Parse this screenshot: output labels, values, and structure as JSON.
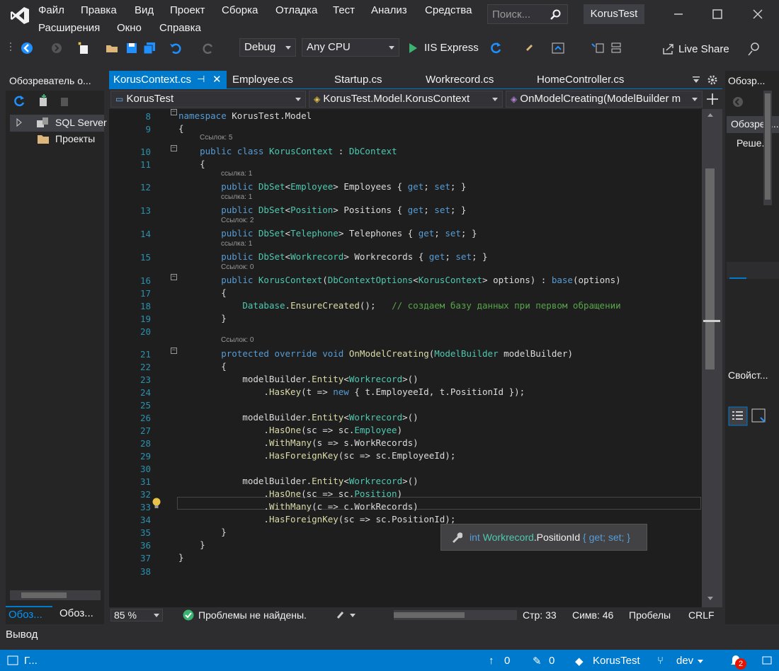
{
  "menu": [
    "Файл",
    "Правка",
    "Вид",
    "Проект",
    "Сборка",
    "Отладка",
    "Тест",
    "Анализ",
    "Средства",
    "Расширения",
    "Окно",
    "Справка"
  ],
  "search": {
    "placeholder": "Поиск..."
  },
  "project_name": "KorusTest",
  "toolbar": {
    "config": "Debug",
    "platform": "Any CPU",
    "run": "IIS Express",
    "live_share": "Live Share"
  },
  "left_panel": {
    "title": "Обозреватель о...",
    "items": [
      "SQL Server",
      "Проекты"
    ],
    "tabs": [
      "Обоз...",
      "Обоз..."
    ]
  },
  "editor_tabs": [
    "KorusContext.cs",
    "Employee.cs",
    "Startup.cs",
    "Workrecord.cs",
    "HomeController.cs"
  ],
  "nav": {
    "project": "KorusTest",
    "class": "KorusTest.Model.KorusContext",
    "member": "OnModelCreating(ModelBuilder m"
  },
  "code_lines": [
    {
      "n": "8",
      "t": "namespace KorusTest.Model"
    },
    {
      "n": "9",
      "t": "{"
    },
    {
      "n": "10",
      "t": "    public class KorusContext : DbContext",
      "lens": "Ссылок: 5"
    },
    {
      "n": "11",
      "t": "    {"
    },
    {
      "n": "12",
      "t": "        public DbSet<Employee> Employees { get; set; }",
      "lens": "ссылка: 1"
    },
    {
      "n": "13",
      "t": "        public DbSet<Position> Positions { get; set; }",
      "lens": "ссылка: 1"
    },
    {
      "n": "14",
      "t": "        public DbSet<Telephone> Telephones { get; set; }",
      "lens": "Ссылок: 2"
    },
    {
      "n": "15",
      "t": "        public DbSet<Workrecord> Workrecords { get; set; }",
      "lens": "ссылка: 1"
    },
    {
      "n": "16",
      "t": "        public KorusContext(DbContextOptions<KorusContext> options) : base(options)",
      "lens": "Ссылок: 0"
    },
    {
      "n": "17",
      "t": "        {"
    },
    {
      "n": "18",
      "t": "            Database.EnsureCreated();   // создаем базу данных при первом обращении"
    },
    {
      "n": "19",
      "t": "        }"
    },
    {
      "n": "20",
      "t": ""
    },
    {
      "n": "21",
      "t": "        protected override void OnModelCreating(ModelBuilder modelBuilder)",
      "lens": "Ссылок: 0"
    },
    {
      "n": "22",
      "t": "        {"
    },
    {
      "n": "23",
      "t": "            modelBuilder.Entity<Workrecord>()"
    },
    {
      "n": "24",
      "t": "                .HasKey(t => new { t.EmployeeId, t.PositionId });"
    },
    {
      "n": "25",
      "t": ""
    },
    {
      "n": "26",
      "t": "            modelBuilder.Entity<Workrecord>()"
    },
    {
      "n": "27",
      "t": "                .HasOne(sc => sc.Employee)"
    },
    {
      "n": "28",
      "t": "                .WithMany(s => s.WorkRecords)"
    },
    {
      "n": "29",
      "t": "                .HasForeignKey(sc => sc.EmployeeId);"
    },
    {
      "n": "30",
      "t": ""
    },
    {
      "n": "31",
      "t": "            modelBuilder.Entity<Workrecord>()"
    },
    {
      "n": "32",
      "t": "                .HasOne(sc => sc.Position)"
    },
    {
      "n": "33",
      "t": "                .WithMany(c => c.WorkRecords)"
    },
    {
      "n": "34",
      "t": "                .HasForeignKey(sc => sc.PositionId);"
    },
    {
      "n": "35",
      "t": "        }"
    },
    {
      "n": "36",
      "t": "    }"
    },
    {
      "n": "37",
      "t": "}"
    },
    {
      "n": "38",
      "t": ""
    }
  ],
  "tooltip": {
    "type": "int",
    "cls": "Workrecord",
    "prop": ".PositionId",
    "body": "{ get; set; }"
  },
  "editor_status": {
    "zoom": "85 %",
    "problems": "Проблемы не найдены.",
    "line": "Стр: 33",
    "col": "Симв: 46",
    "spaces": "Пробелы",
    "eol": "CRLF"
  },
  "right_panel": {
    "title": "Обозр...",
    "search": "Обозрев...",
    "solution": "Реше...",
    "props": "Свойст..."
  },
  "output_title": "Вывод",
  "statusbar": {
    "left": "Г...",
    "up": "0",
    "edits": "0",
    "repo": "KorusTest",
    "branch": "dev",
    "notifications": "2"
  }
}
